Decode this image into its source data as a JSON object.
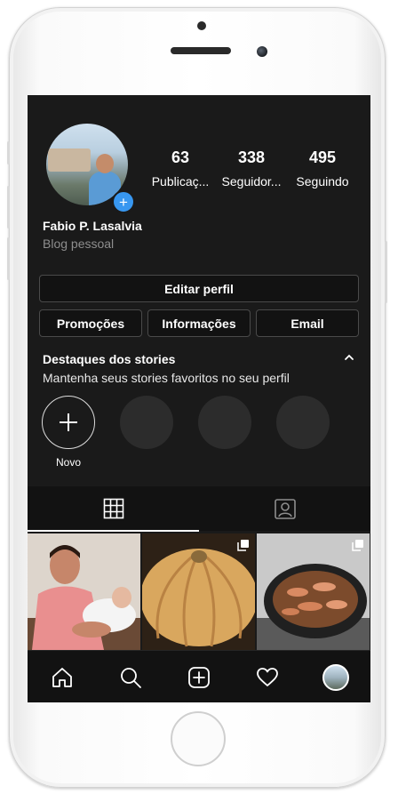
{
  "profile": {
    "name": "Fabio P. Lasalvia",
    "bio": "Blog pessoal",
    "stats": [
      {
        "value": "63",
        "label": "Publicaç..."
      },
      {
        "value": "338",
        "label": "Seguidor..."
      },
      {
        "value": "495",
        "label": "Seguindo"
      }
    ]
  },
  "buttons": {
    "edit_profile": "Editar perfil",
    "promotions": "Promoções",
    "info": "Informações",
    "email": "Email"
  },
  "highlights": {
    "title": "Destaques dos stories",
    "subtitle": "Mantenha seus stories favoritos no seu perfil",
    "new_label": "Novo"
  },
  "tabs": [
    {
      "name": "grid",
      "icon": "grid-icon",
      "active": true
    },
    {
      "name": "tagged",
      "icon": "tagged-person-icon",
      "active": false
    }
  ],
  "posts": [
    {
      "subject": "man-holding-baby"
    },
    {
      "subject": "pumpkin",
      "multiple": true
    },
    {
      "subject": "shrimp-in-pan",
      "multiple": true
    }
  ],
  "nav": [
    "home-icon",
    "search-icon",
    "new-post-icon",
    "heart-icon",
    "profile-avatar"
  ],
  "colors": {
    "background": "#1a1a1a",
    "bar": "#121212",
    "accent": "#3897f0",
    "muted_text": "#8e8e8e"
  }
}
